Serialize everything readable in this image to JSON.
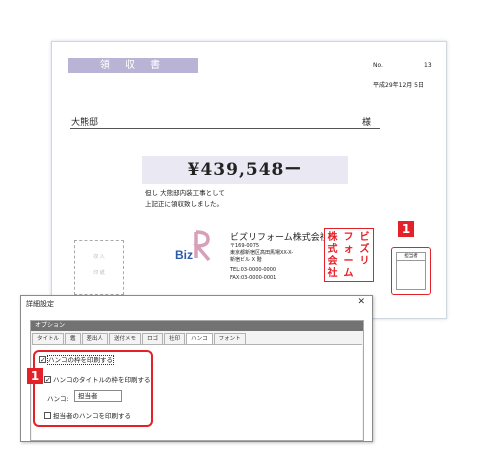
{
  "receipt": {
    "title": "領 収 書",
    "no_label": "No.",
    "no_value": "13",
    "date": "平成29年12月 5日",
    "addressee": "大熊邸",
    "honorific": "様",
    "amount": "¥439,548ー",
    "note_line1": "但し 大熊邸内装工事として",
    "note_line2": "上記正に領収致しました。",
    "revenue_stamp_line1": "収 入",
    "revenue_stamp_line2": "印 紙",
    "company": "ビズリフォーム株式会社",
    "address_lines": [
      "〒169-0075",
      "東京都新宿区高田馬場XX-X-",
      "新宿ビル X 階",
      "TEL:03-0000-0000",
      "FAX:03-0000-0001"
    ],
    "hanko_text": "ビズリフォーム株式会社",
    "person_in_charge_label": "担当者",
    "logo_text": "BizR"
  },
  "callouts": {
    "badge_top": "1",
    "badge_dialog": "1"
  },
  "dialog": {
    "title": "詳細設定",
    "close_icon": "close-icon",
    "section_header": "オプション",
    "tabs": [
      "タイトル",
      "鑑",
      "差出人",
      "送付メモ",
      "ロゴ",
      "社印",
      "ハンコ",
      "フォント"
    ],
    "active_tab": "ハンコ",
    "options": {
      "print_hanko_frame": {
        "label": "ハンコの枠を印刷する",
        "checked": true
      },
      "print_hanko_title_frame": {
        "label": "ハンコのタイトルの枠を印刷する",
        "checked": true
      },
      "hanko_label": "ハンコ:",
      "hanko_value": "担当者",
      "print_person_hanko": {
        "label": "担当者のハンコを印刷する",
        "checked": false
      }
    }
  },
  "colors": {
    "accent_red": "#e42128",
    "title_purple": "#b9b3d6",
    "amount_bg": "#e9e8f3",
    "logo_blue": "#2a5aa8"
  }
}
